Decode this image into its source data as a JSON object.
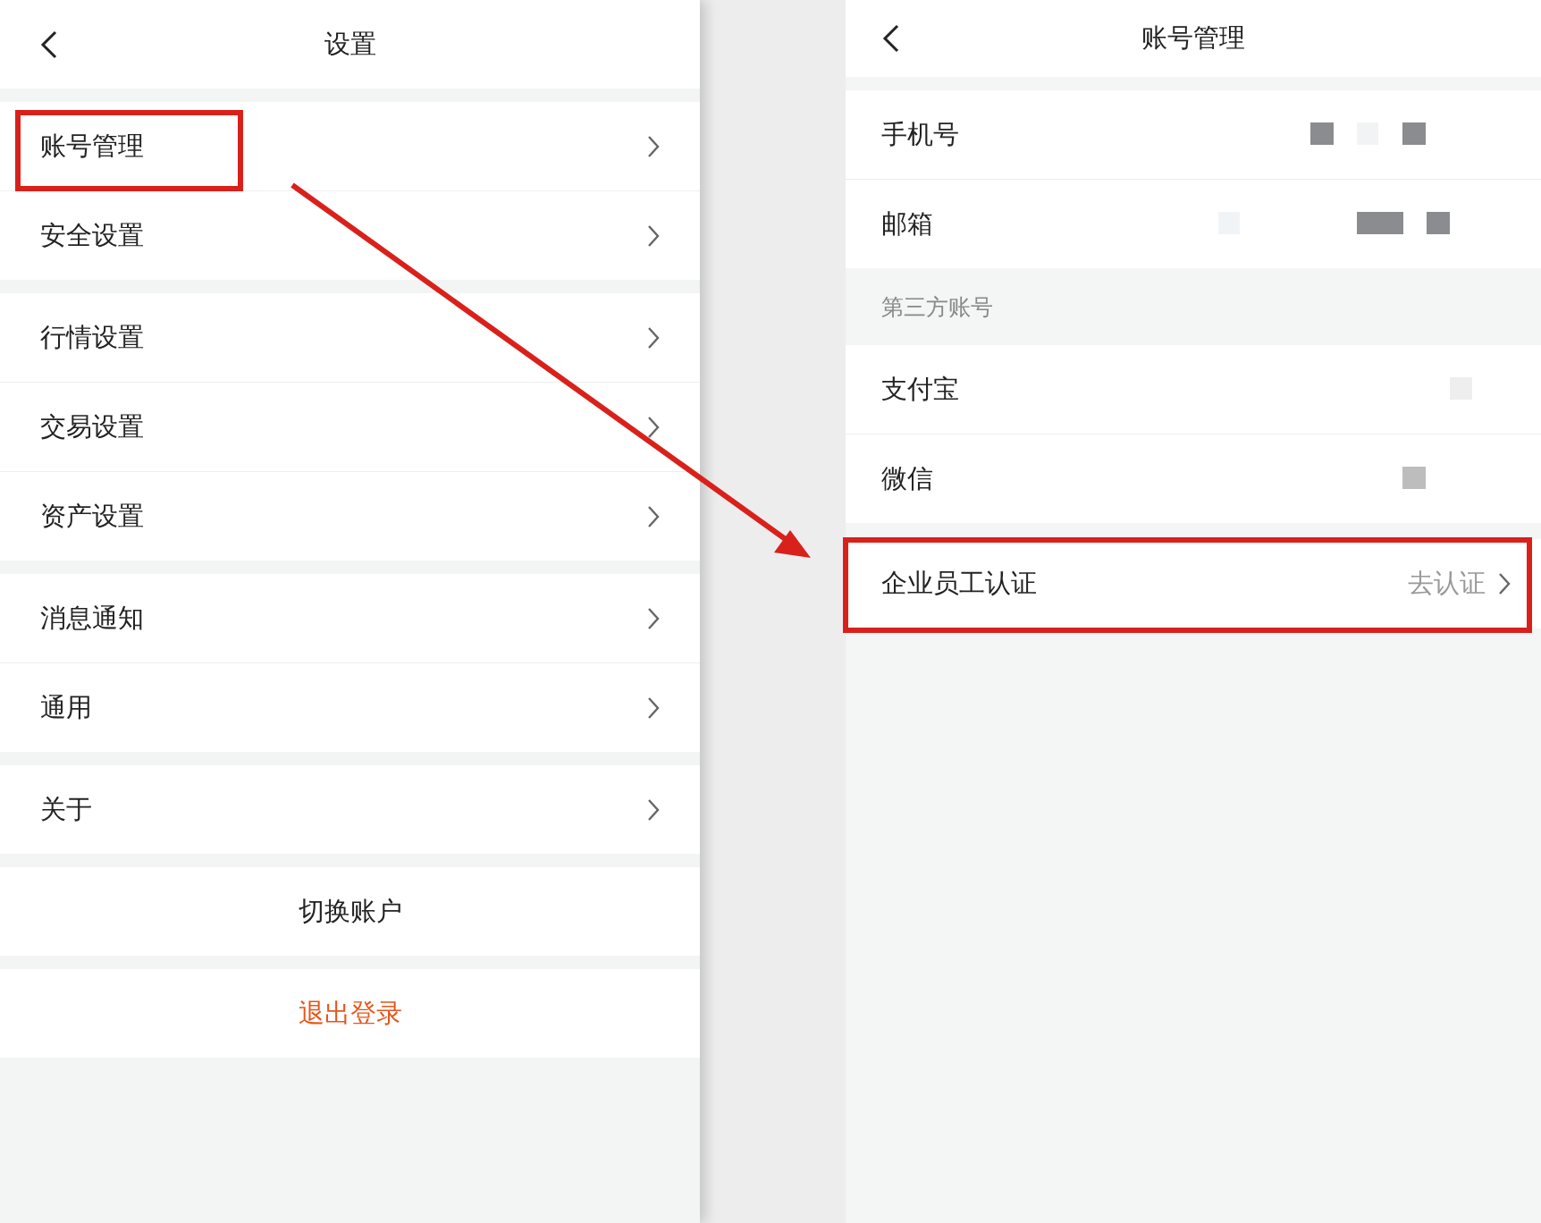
{
  "settings": {
    "title": "设置",
    "groups": [
      {
        "items": [
          {
            "label": "账号管理"
          },
          {
            "label": "安全设置"
          }
        ]
      },
      {
        "items": [
          {
            "label": "行情设置"
          },
          {
            "label": "交易设置"
          },
          {
            "label": "资产设置"
          }
        ]
      },
      {
        "items": [
          {
            "label": "消息通知"
          },
          {
            "label": "通用"
          }
        ]
      },
      {
        "items": [
          {
            "label": "关于"
          }
        ]
      }
    ],
    "actions": [
      {
        "label": "切换账户",
        "kind": "normal"
      },
      {
        "label": "退出登录",
        "kind": "danger"
      }
    ]
  },
  "account": {
    "title": "账号管理",
    "rows": [
      {
        "label": "手机号"
      },
      {
        "label": "邮箱"
      }
    ],
    "section_label": "第三方账号",
    "third_party": [
      {
        "label": "支付宝"
      },
      {
        "label": "微信"
      }
    ],
    "verify": {
      "label": "企业员工认证",
      "action": "去认证"
    }
  }
}
